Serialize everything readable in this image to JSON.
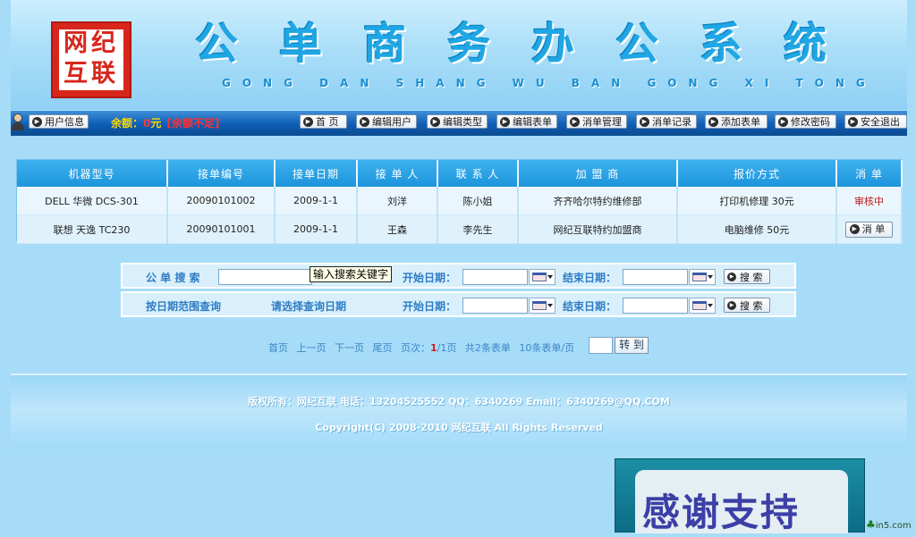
{
  "header": {
    "logo_chars": [
      "网",
      "纪",
      "互",
      "联"
    ],
    "title": "公单商务办公系统",
    "subtitle": "GONG DAN SHANG WU BAN GONG XI TONG"
  },
  "navbar": {
    "user_info": "用户信息",
    "balance_label": "余额：",
    "balance_amount": "0",
    "balance_unit": "元",
    "balance_warning": "[余额不足]",
    "items": [
      "首 页",
      "编辑用户",
      "编辑类型",
      "编辑表单",
      "消单管理",
      "消单记录",
      "添加表单",
      "修改密码",
      "安全退出"
    ]
  },
  "table": {
    "headers": [
      "机器型号",
      "接单编号",
      "接单日期",
      "接 单 人",
      "联 系 人",
      "加 盟 商",
      "报价方式",
      "消 单"
    ],
    "rows": [
      {
        "model": "DELL 华微 DCS-301",
        "order_no": "20090101002",
        "date": "2009-1-1",
        "receiver": "刘洋",
        "contact": "陈小姐",
        "franchisee": "齐齐哈尔特约维修部",
        "quote": "打印机修理 30元",
        "status": "审核中"
      },
      {
        "model": "联想 天逸 TC230",
        "order_no": "20090101001",
        "date": "2009-1-1",
        "receiver": "王森",
        "contact": "李先生",
        "franchisee": "网纪互联特约加盟商",
        "quote": "电脑维修 50元",
        "action": "消 单"
      }
    ]
  },
  "search": {
    "row1_label": "公 单 搜 索",
    "keyword_tooltip": "输入搜索关键字",
    "start_label": "开始日期：",
    "end_label": "结束日期：",
    "button": "搜 索",
    "row2_label": "按日期范围查询",
    "row2_hint": "请选择查询日期"
  },
  "pager": {
    "first": "首页",
    "prev": "上一页",
    "next": "下一页",
    "last": "尾页",
    "page_label": "页次：",
    "current": "1",
    "total": "/1页",
    "count": "共2条表单",
    "per_page": "10条表单/页",
    "goto": "转 到"
  },
  "footer": {
    "line1": "版权所有：网纪互联 电话：13204525552 QQ：6340269 Email：6340269@QQ.COM",
    "line2": "Copyright(C) 2008-2010 网纪互联 All Rights Reserved"
  },
  "ad": {
    "text": "感谢支持"
  },
  "watermark": {
    "text": "in5.com"
  },
  "colors": {
    "nav_bg": "#1060b8",
    "header_title": "#1fa6e4",
    "warning": "#ff3030",
    "status_pending": "#c01818"
  }
}
